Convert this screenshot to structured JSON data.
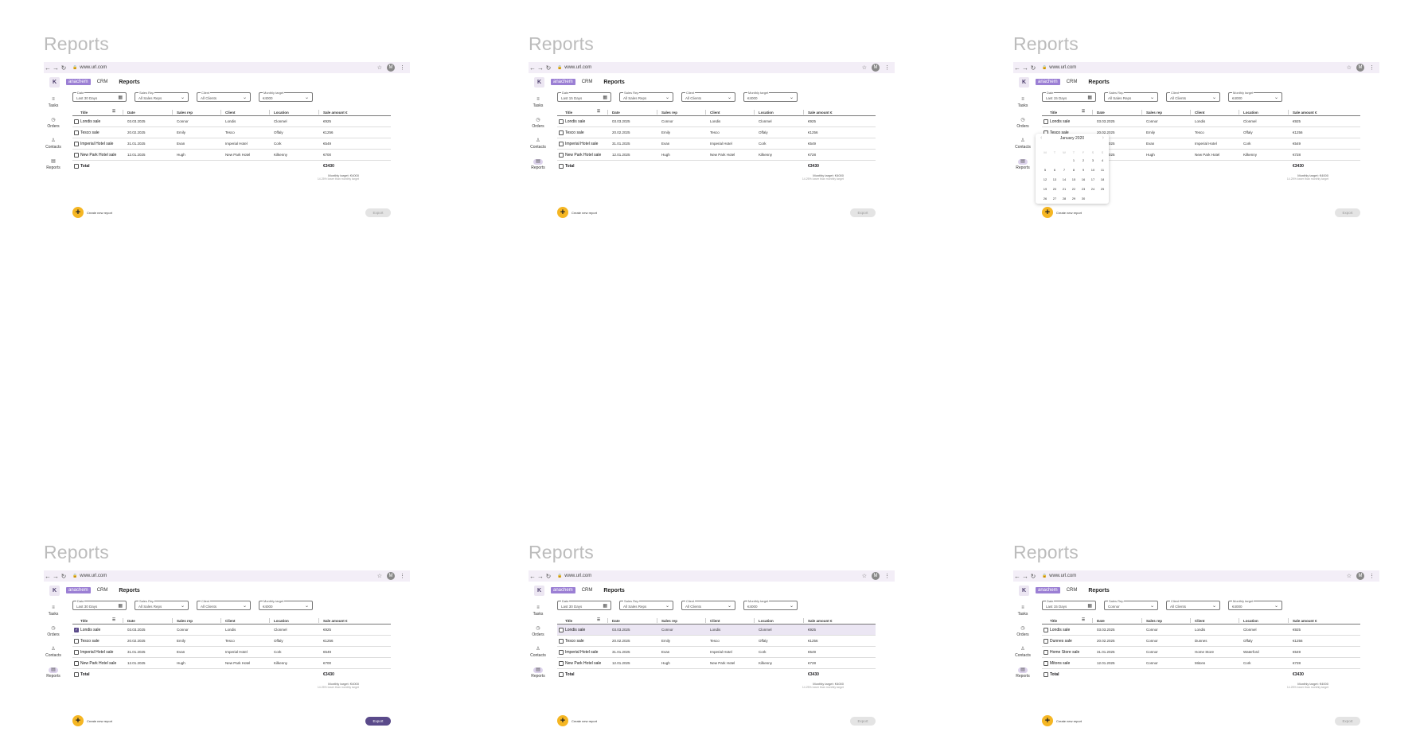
{
  "heading": "Reports",
  "browser": {
    "url": "www.url.com",
    "avatar": "M",
    "back": "←",
    "forward": "→",
    "reload": "↻",
    "star": "☆",
    "menu": "⋮",
    "lock": "🔒"
  },
  "topbar": {
    "logo": "K",
    "brand": "anachem",
    "crm": "CRM",
    "title": "Reports"
  },
  "sidebar": [
    {
      "icon": "tasks-icon",
      "glyph": "≡",
      "label": "Tasks"
    },
    {
      "icon": "orders-icon",
      "glyph": "◷",
      "label": "Orders"
    },
    {
      "icon": "contacts-icon",
      "glyph": "♙",
      "label": "Contacts"
    },
    {
      "icon": "reports-icon",
      "glyph": "▤",
      "label": "Reports"
    }
  ],
  "filters": {
    "date_label": "Date",
    "sales_rep_label": "Sales Rep",
    "client_label": "Client",
    "target_label": "Monthly target"
  },
  "columns": [
    "Title",
    "Date",
    "Sales rep",
    "Client",
    "Location",
    "Sale amount €"
  ],
  "common": {
    "total_label": "Total",
    "total_value": "€3430",
    "monthly_target": "Monthly target: €4000",
    "target_note": "14.25% lower than monthly target",
    "create": "Create new report",
    "export": "Export"
  },
  "calendar": {
    "month": "January 2020",
    "weekdays": [
      "M",
      "T",
      "W",
      "T",
      "F",
      "S",
      "S"
    ],
    "days": [
      "",
      "",
      "",
      "1",
      "2",
      "3",
      "4",
      "5",
      "6",
      "7",
      "8",
      "9",
      "10",
      "11",
      "12",
      "13",
      "14",
      "15",
      "16",
      "17",
      "18",
      "19",
      "20",
      "21",
      "22",
      "23",
      "24",
      "25",
      "26",
      "27",
      "28",
      "29",
      "30"
    ]
  },
  "frames": [
    {
      "id": "f1",
      "date": "Last 30 Days",
      "rep": "All Sales Reps",
      "client": "All Clients",
      "target": "€4000",
      "rows": [
        [
          "Londis sale",
          "03.03.2025",
          "Connor",
          "Londis",
          "Clonmel",
          "€925"
        ],
        [
          "Tesco sale",
          "20.02.2025",
          "Emily",
          "Tesco",
          "Offaly",
          "€1256"
        ],
        [
          "Imperial Hotel sale",
          "31.01.2025",
          "Evan",
          "Imperial Hotel",
          "Cork",
          "€549"
        ],
        [
          "New Park Hotel sale",
          "12.01.2025",
          "Hugh",
          "New Park Hotel",
          "Kilkenny",
          "€700"
        ]
      ],
      "checked": [],
      "highlight": -1,
      "export_on": false,
      "calendar": false
    },
    {
      "id": "f2",
      "date": "Last 15 Days",
      "rep": "All Sales Reps",
      "client": "All Clients",
      "target": "€4000",
      "rows": [
        [
          "Londis sale",
          "03.03.2025",
          "Connor",
          "Londis",
          "Clonmel",
          "€925"
        ],
        [
          "Tesco sale",
          "20.02.2025",
          "Emily",
          "Tesco",
          "Offaly",
          "€1256"
        ],
        [
          "Imperial Hotel sale",
          "31.01.2025",
          "Evan",
          "Imperial Hotel",
          "Cork",
          "€549"
        ],
        [
          "New Park Hotel sale",
          "12.01.2025",
          "Hugh",
          "New Park Hotel",
          "Kilkenny",
          "€728"
        ]
      ],
      "checked": [],
      "highlight": -1,
      "export_on": false,
      "calendar": false
    },
    {
      "id": "f3",
      "date": "Last 15 Days",
      "rep": "All Sales Reps",
      "client": "All Clients",
      "target": "€4000",
      "rows": [
        [
          "Londis sale",
          "03.03.2025",
          "Connor",
          "Londis",
          "Clonmel",
          "€925"
        ],
        [
          "Tesco sale",
          "20.02.2025",
          "Emily",
          "Tesco",
          "Offaly",
          "€1256"
        ],
        [
          "Imperial Hotel sale",
          "31.01.2025",
          "Evan",
          "Imperial Hotel",
          "Cork",
          "€549"
        ],
        [
          "New Park Hotel sale",
          "12.01.2025",
          "Hugh",
          "New Park Hotel",
          "Kilkenny",
          "€728"
        ]
      ],
      "checked": [],
      "highlight": -1,
      "export_on": false,
      "calendar": true
    },
    {
      "id": "f4",
      "date": "Last 30 Days",
      "rep": "All Sales Reps",
      "client": "All Clients",
      "target": "€4000",
      "rows": [
        [
          "Londis sale",
          "03.03.2025",
          "Connor",
          "Londis",
          "Clonmel",
          "€925"
        ],
        [
          "Tesco sale",
          "20.02.2025",
          "Emily",
          "Tesco",
          "Offaly",
          "€1256"
        ],
        [
          "Imperial Hotel sale",
          "31.01.2025",
          "Evan",
          "Imperial Hotel",
          "Cork",
          "€549"
        ],
        [
          "New Park Hotel sale",
          "12.01.2025",
          "Hugh",
          "New Park Hotel",
          "Kilkenny",
          "€700"
        ]
      ],
      "checked": [
        0
      ],
      "highlight": -1,
      "export_on": true,
      "calendar": false
    },
    {
      "id": "f5",
      "date": "Last 30 Days",
      "rep": "All Sales Reps",
      "client": "All Clients",
      "target": "€4000",
      "rows": [
        [
          "Londis sale",
          "03.03.2025",
          "Connor",
          "Londis",
          "Clonmel",
          "€925"
        ],
        [
          "Tesco sale",
          "20.02.2025",
          "Emily",
          "Tesco",
          "Offaly",
          "€1256"
        ],
        [
          "Imperial Hotel sale",
          "31.01.2025",
          "Evan",
          "Imperial Hotel",
          "Cork",
          "€549"
        ],
        [
          "New Park Hotel sale",
          "12.01.2025",
          "Hugh",
          "New Park Hotel",
          "Kilkenny",
          "€728"
        ]
      ],
      "checked": [],
      "highlight": 0,
      "export_on": false,
      "calendar": false
    },
    {
      "id": "f6",
      "date": "Last 15 Days",
      "rep": "Connor",
      "client": "All Clients",
      "target": "€4000",
      "rows": [
        [
          "Londis sale",
          "03.03.2025",
          "Connor",
          "Londis",
          "Clonmel",
          "€925"
        ],
        [
          "Dunnes sale",
          "20.02.2025",
          "Connor",
          "Dunnes",
          "Offaly",
          "€1256"
        ],
        [
          "Home Store sale",
          "31.01.2025",
          "Connor",
          "Home Store",
          "Waterford",
          "€549"
        ],
        [
          "Mitons sale",
          "12.01.2025",
          "Connor",
          "Mitons",
          "Cork",
          "€728"
        ]
      ],
      "checked": [],
      "highlight": -1,
      "export_on": false,
      "calendar": false
    }
  ]
}
